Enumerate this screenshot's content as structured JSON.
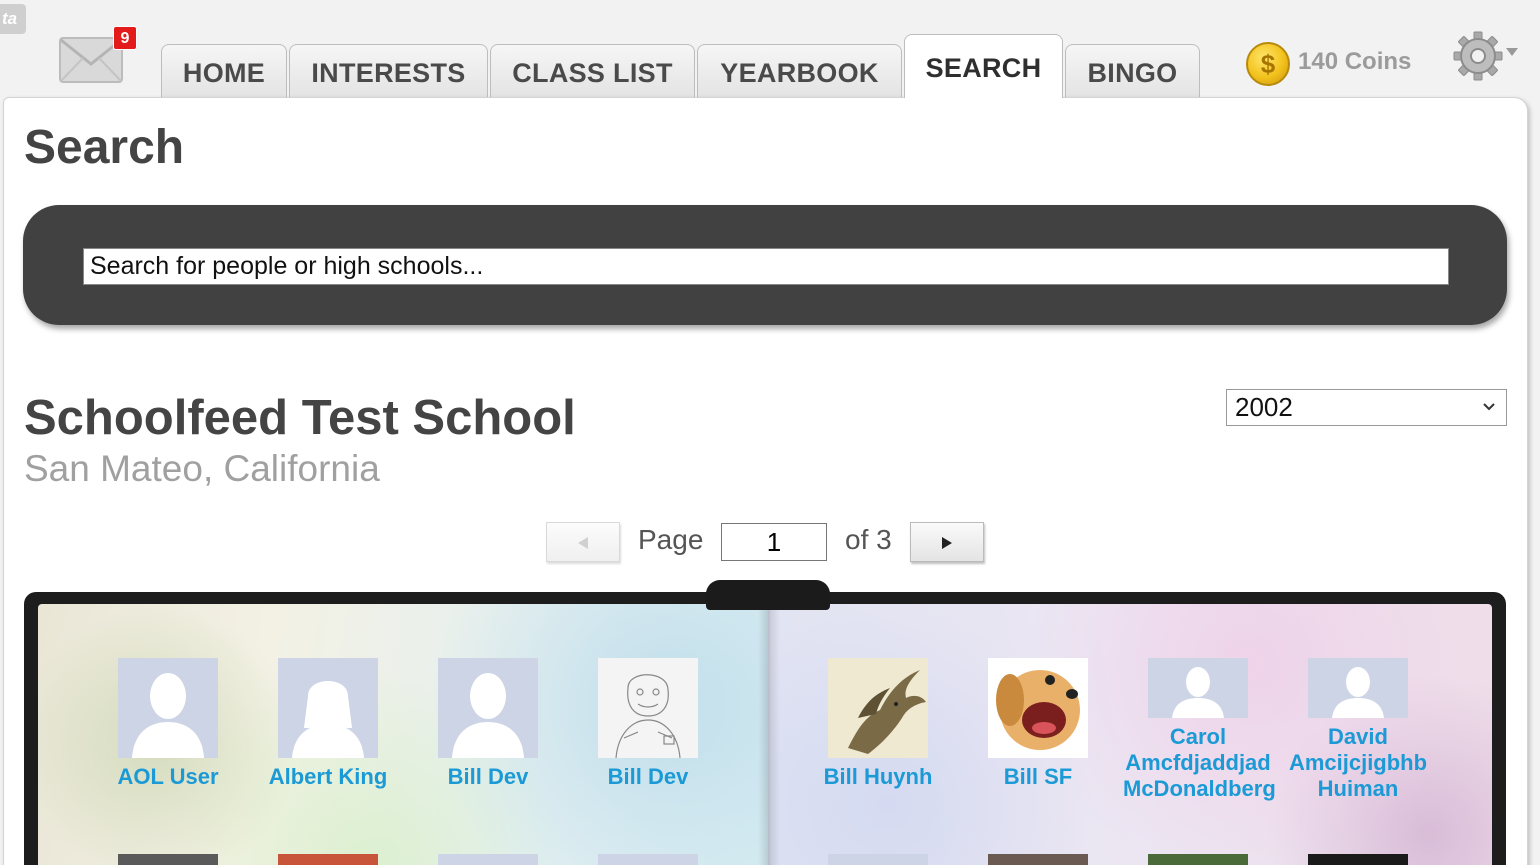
{
  "corner_tag": "ta",
  "header": {
    "mail_badge_count": "9",
    "tabs": [
      {
        "label": "HOME"
      },
      {
        "label": "INTERESTS"
      },
      {
        "label": "CLASS LIST"
      },
      {
        "label": "YEARBOOK"
      },
      {
        "label": "SEARCH",
        "active": true
      },
      {
        "label": "BINGO"
      }
    ],
    "coins_label": "140 Coins",
    "coin_symbol": "$"
  },
  "main": {
    "title": "Search",
    "search": {
      "placeholder": "Search for people or high schools..."
    },
    "school": {
      "name": "Schoolfeed Test School",
      "location": "San Mateo, California"
    },
    "year_select": {
      "value": "2002"
    },
    "pager": {
      "page_label": "Page",
      "current_page": "1",
      "of_label": "of 3"
    },
    "yearbook": {
      "people": [
        {
          "name": "AOL User",
          "photo": "silhouette"
        },
        {
          "name": "Albert King",
          "photo": "silhouette"
        },
        {
          "name": "Bill Dev",
          "photo": "silhouette"
        },
        {
          "name": "Bill Dev",
          "photo": "sketch"
        },
        {
          "name": "Bill Huynh",
          "photo": "dragon"
        },
        {
          "name": "Bill SF",
          "photo": "puppy"
        },
        {
          "name_lines": [
            "Carol",
            "Amcfdjaddjad",
            "McDonaldberg"
          ],
          "photo": "silhouette"
        },
        {
          "name_lines": [
            "David",
            "Amcijcjigbhb",
            "Huiman"
          ],
          "photo": "silhouette"
        }
      ]
    }
  },
  "colors": {
    "accent_link": "#1b9ad6",
    "search_bar": "#414141",
    "badge": "#e41b1b",
    "coin": "#f2c21c"
  }
}
